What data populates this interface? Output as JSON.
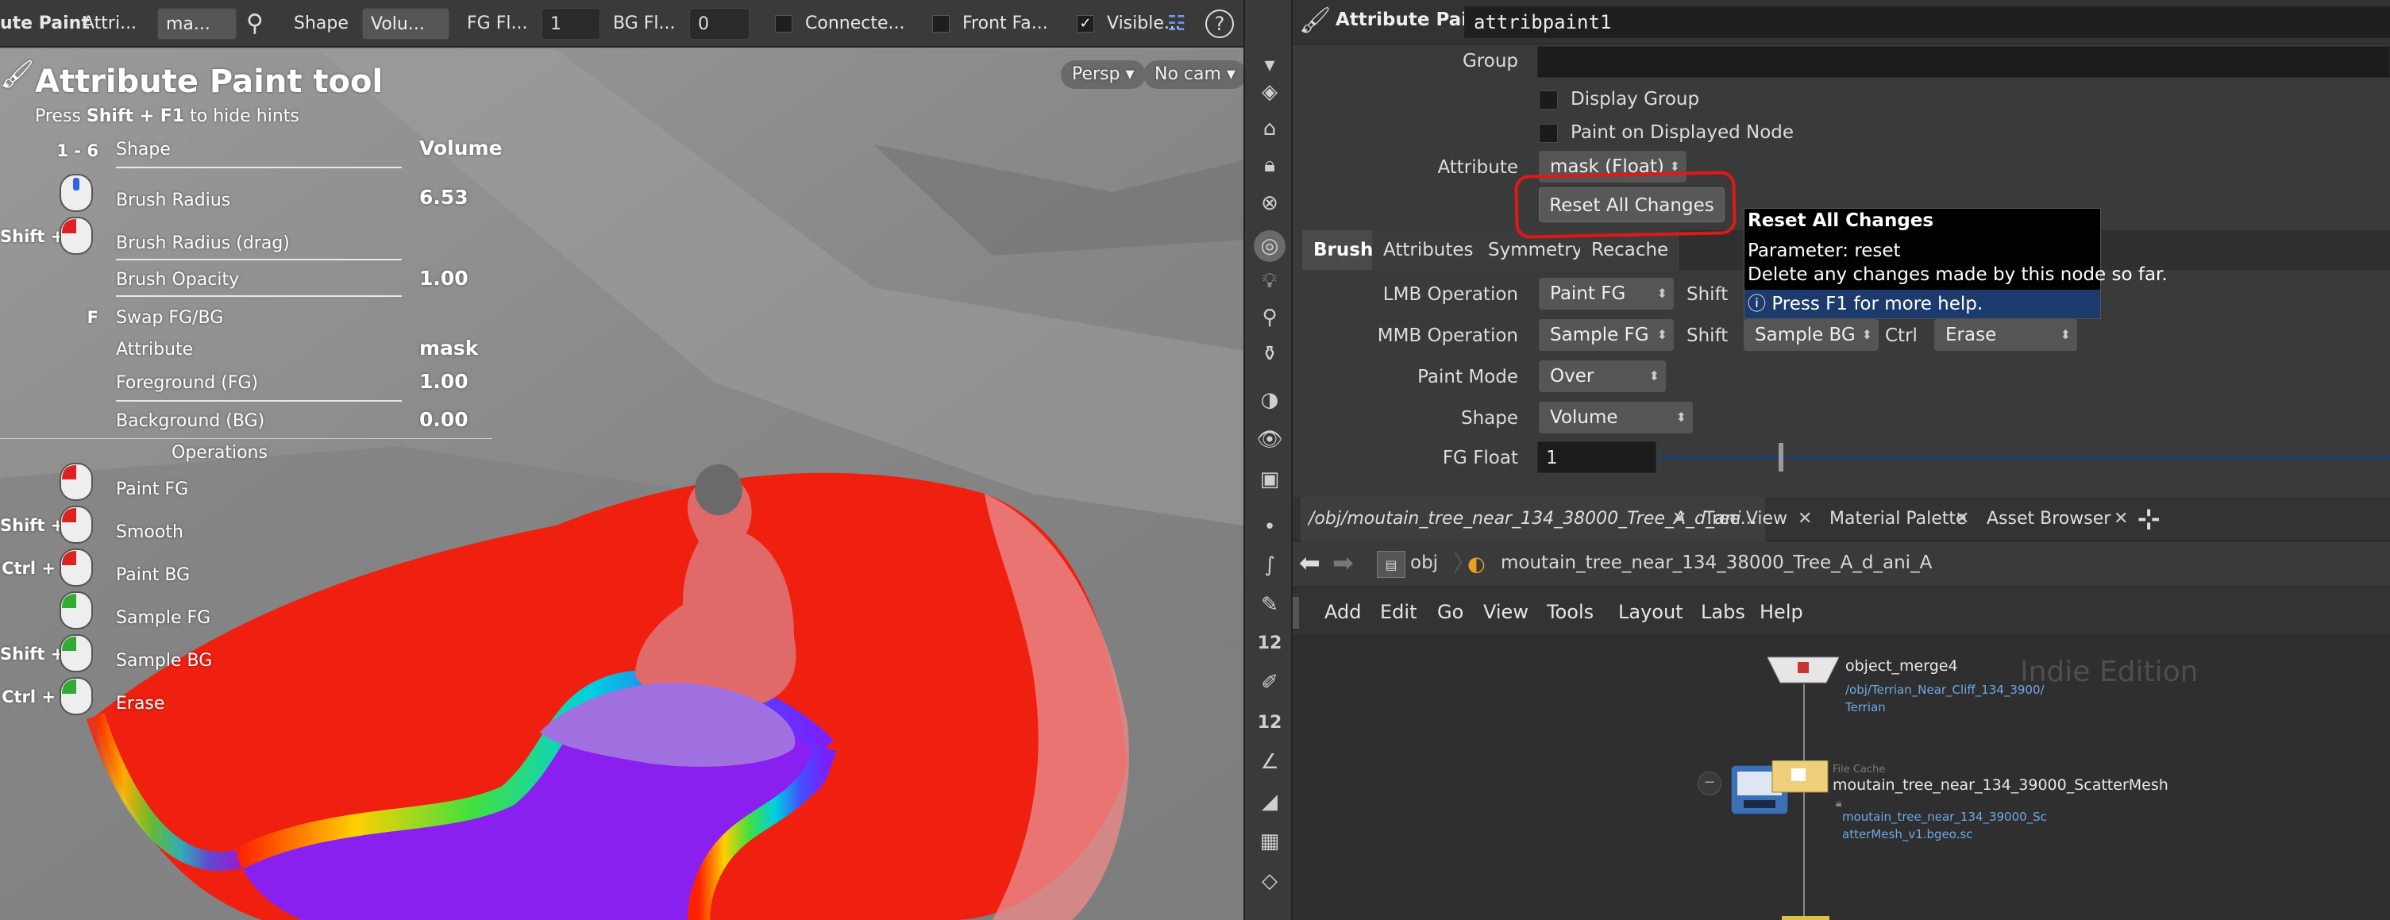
{
  "viewport_toolbar": {
    "tool_name": "ute Paint",
    "attrib_label": "Attri...",
    "attrib_value": "ma...",
    "shape_label": "Shape",
    "shape_value": "Volu...",
    "fg_label": "FG Fl...",
    "fg_value": "1",
    "bg_label": "BG Fl...",
    "bg_value": "0",
    "connected_label": "Connecte...",
    "frontface_label": "Front Fa...",
    "visible_label": "Visible...",
    "help_glyph": "?"
  },
  "hud": {
    "title": "Attribute Paint tool",
    "hint_prefix": "Press ",
    "hint_key": "Shift + F1",
    "hint_suffix": " to hide hints",
    "rows": [
      {
        "key": "1 - 6",
        "label": "Shape",
        "value": "Volume"
      },
      {
        "key": "",
        "label": "Brush Radius",
        "value": "6.53"
      },
      {
        "key": "Shift +",
        "label": "Brush Radius (drag)",
        "value": ""
      },
      {
        "key": "",
        "label": "Brush Opacity",
        "value": "1.00"
      },
      {
        "key": "F",
        "label": "Swap FG/BG",
        "value": ""
      },
      {
        "key": "",
        "label": "Attribute",
        "value": "mask"
      },
      {
        "key": "",
        "label": "Foreground (FG)",
        "value": "1.00"
      },
      {
        "key": "",
        "label": "Background (BG)",
        "value": "0.00"
      }
    ],
    "operations_header": "Operations",
    "operations": [
      {
        "key": "",
        "label": "Paint FG",
        "color": "#d22"
      },
      {
        "key": "Shift +",
        "label": "Smooth",
        "color": "#d22"
      },
      {
        "key": "Ctrl +",
        "label": "Paint BG",
        "color": "#d22"
      },
      {
        "key": "",
        "label": "Sample FG",
        "color": "#3a3"
      },
      {
        "key": "Shift +",
        "label": "Sample BG",
        "color": "#3a3"
      },
      {
        "key": "Ctrl +",
        "label": "Erase",
        "color": "#3a3"
      }
    ],
    "persp_label": "Persp",
    "cam_label": "No cam"
  },
  "vstrip": {
    "num1": "12",
    "num2": "12"
  },
  "param_pane": {
    "title": "Attribute Paint",
    "node_name": "attribpaint1",
    "group_label": "Group",
    "group_value": "",
    "display_group_label": "Display Group",
    "paint_displayed_label": "Paint on Displayed Node",
    "attribute_label": "Attribute",
    "attribute_value": "mask (Float)",
    "reset_button": "Reset All Changes",
    "tabs": [
      "Brush",
      "Attributes",
      "Symmetry",
      "Recache"
    ],
    "lmb_label": "LMB Operation",
    "lmb_value": "Paint FG",
    "mmb_label": "MMB Operation",
    "mmb_value": "Sample FG",
    "shift_label": "Shift",
    "shift_value": "Sample BG",
    "ctrl_label": "Ctrl",
    "ctrl_value": "Erase",
    "paint_mode_label": "Paint Mode",
    "paint_mode_value": "Over",
    "shape_label": "Shape",
    "shape_value": "Volume",
    "fg_float_label": "FG Float",
    "fg_float_value": "1"
  },
  "tooltip": {
    "title": "Reset All Changes",
    "param": "Parameter: reset",
    "desc": "Delete any changes made by this node so far.",
    "help": "Press F1 for more help."
  },
  "network": {
    "tabs": [
      "/obj/moutain_tree_near_134_38000_Tree_A_d_ani...",
      "Tree View",
      "Material Palette",
      "Asset Browser"
    ],
    "path_obj": "obj",
    "path_node": "moutain_tree_near_134_38000_Tree_A_d_ani_A",
    "menu": [
      "Add",
      "Edit",
      "Go",
      "View",
      "Tools",
      "Layout",
      "Labs",
      "Help"
    ],
    "watermark": "Indie Edition",
    "node1_name": "object_merge4",
    "node1_link1": "/obj/Terrian_Near_Cliff_134_3900/",
    "node1_link2": "Terrian",
    "node2_label": "File Cache",
    "node2_name": "moutain_tree_near_134_39000_ScatterMesh",
    "node2_link1": "moutain_tree_near_134_39000_Sc",
    "node2_link2": "atterMesh_v1.bgeo.sc"
  }
}
